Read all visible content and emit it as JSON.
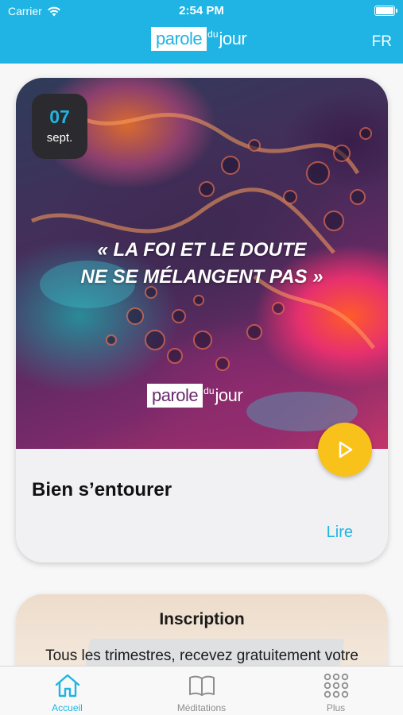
{
  "status_bar": {
    "carrier": "Carrier",
    "time": "2:54 PM",
    "battery_icon": "battery-icon",
    "wifi_icon": "wifi-icon"
  },
  "header": {
    "logo": {
      "parole": "parole",
      "du": "du",
      "jour": "jour"
    },
    "language": "FR",
    "background_color": "#1fb4e3"
  },
  "featured": {
    "date": {
      "day": "07",
      "month": "sept."
    },
    "quote_lines": [
      "« LA FOI ET LE DOUTE",
      "NE SE MÉLANGENT PAS »"
    ],
    "image_logo": {
      "parole": "parole",
      "du": "du",
      "jour": "jour"
    },
    "title": "Bien s’entourer",
    "read_label": "Lire",
    "play_icon": "play-icon",
    "accent_color": "#f9c21a"
  },
  "signup_card": {
    "title": "Inscription",
    "text": "Tous les trimestres, recevez gratuitement votre"
  },
  "tabbar": {
    "tabs": [
      {
        "label": "Accueil",
        "icon": "home-icon",
        "active": true
      },
      {
        "label": "Méditations",
        "icon": "book-icon",
        "active": false
      },
      {
        "label": "Plus",
        "icon": "grid-icon",
        "active": false
      }
    ]
  }
}
